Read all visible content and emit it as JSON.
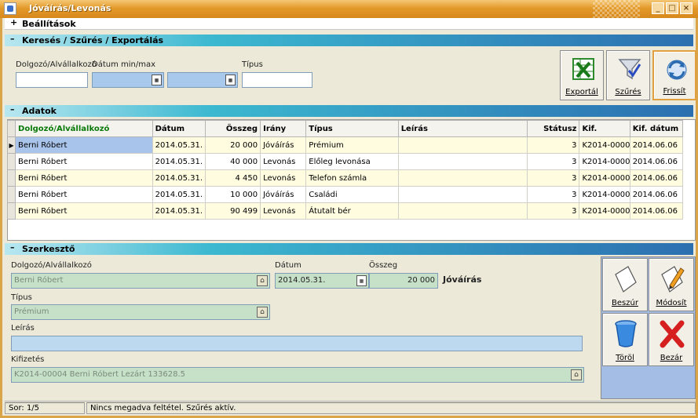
{
  "window": {
    "title": "Jóváírás/Levonás"
  },
  "sections": {
    "settings": {
      "toggle": "+",
      "label": "Beállítások"
    },
    "search": {
      "toggle": "–",
      "label": "Keresés / Szűrés / Exportálás"
    },
    "data": {
      "toggle": "–",
      "label": "Adatok"
    },
    "editor": {
      "toggle": "–",
      "label": "Szerkesztő"
    }
  },
  "search": {
    "employee_label": "Dolgozó/Alvállalkozó",
    "date_label": "Dátum min/max",
    "type_label": "Típus",
    "employee_value": "",
    "date_min": "",
    "date_max": "",
    "type_value": ""
  },
  "toolbar": {
    "export_label": "Exportál",
    "filter_label": "Szűrés",
    "refresh_label": "Frissít"
  },
  "grid": {
    "columns": [
      "Dolgozó/Alvállalkozó",
      "Dátum",
      "Összeg",
      "Irány",
      "Típus",
      "Leírás",
      "Státusz",
      "Kif.",
      "Kif. dátum"
    ],
    "rows": [
      [
        "Berni Róbert",
        "2014.05.31.",
        "20 000",
        "Jóváírás",
        "Prémium",
        "",
        "3",
        "K2014-0000",
        "2014.06.06"
      ],
      [
        "Berni Róbert",
        "2014.05.31.",
        "40 000",
        "Levonás",
        "Előleg levonása",
        "",
        "3",
        "K2014-0000",
        "2014.06.06"
      ],
      [
        "Berni Róbert",
        "2014.05.31.",
        "4 450",
        "Levonás",
        "Telefon számla",
        "",
        "3",
        "K2014-0000",
        "2014.06.06"
      ],
      [
        "Berni Róbert",
        "2014.05.31.",
        "10 000",
        "Jóváírás",
        "Családi",
        "",
        "3",
        "K2014-0000",
        "2014.06.06"
      ],
      [
        "Berni Róbert",
        "2014.05.31.",
        "90 499",
        "Levonás",
        "Átutalt bér",
        "",
        "3",
        "K2014-0000",
        "2014.06.06"
      ]
    ]
  },
  "editor": {
    "employee_label": "Dolgozó/Alvállalkozó",
    "employee_value": "Berni Róbert",
    "date_label": "Dátum",
    "date_value": "2014.05.31.",
    "amount_label": "Összeg",
    "amount_value": "20 000",
    "direction_value": "Jóváírás",
    "type_label": "Típus",
    "type_value": "Prémium",
    "description_label": "Leírás",
    "description_value": "",
    "payment_label": "Kifizetés",
    "payment_value": "K2014-00004 Berni Róbert Lezárt 133628.5"
  },
  "actions": {
    "insert_label": "Beszúr",
    "modify_label": "Módosít",
    "delete_label": "Töröl",
    "close_label": "Bezár"
  },
  "status": {
    "row_info": "Sor: 1/5",
    "message": "Nincs megadva feltétel. Szűrés aktív."
  }
}
